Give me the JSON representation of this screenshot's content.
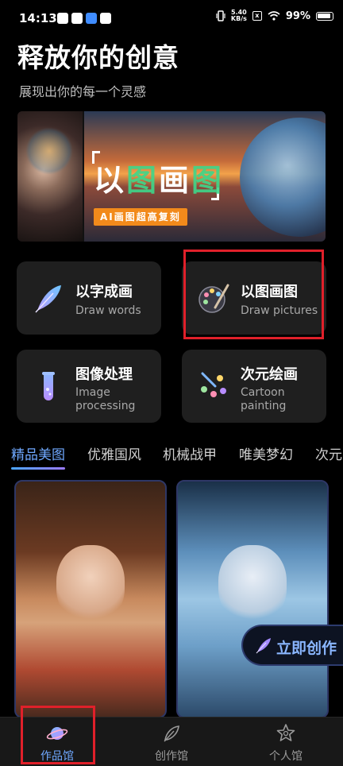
{
  "status_bar": {
    "time": "14:13",
    "net_speed_value": "5.40",
    "net_speed_unit": "KB/s",
    "battery": "99%",
    "sim_label": "x"
  },
  "header": {
    "title": "释放你的创意",
    "subtitle": "展现出你的每一个灵感"
  },
  "banner": {
    "title_part1": "以",
    "title_part2": "图",
    "title_part3": "画",
    "title_part4": "图",
    "tag": "AI画图超高复刻"
  },
  "features": [
    {
      "cn": "以字成画",
      "en": "Draw words",
      "icon": "feather-icon"
    },
    {
      "cn": "以图画图",
      "en": "Draw pictures",
      "icon": "palette-icon"
    },
    {
      "cn": "图像处理",
      "en": "Image processing",
      "icon": "test-tube-icon"
    },
    {
      "cn": "次元绘画",
      "en": "Cartoon painting",
      "icon": "paintbrush-icon"
    }
  ],
  "tabs": [
    "精品美图",
    "优雅国风",
    "机械战甲",
    "唯美梦幻",
    "次元"
  ],
  "cta": {
    "label": "立即创作"
  },
  "nav": [
    {
      "label": "作品馆",
      "icon": "planet-icon"
    },
    {
      "label": "创作馆",
      "icon": "leaf-icon"
    },
    {
      "label": "个人馆",
      "icon": "star-icon"
    }
  ],
  "colors": {
    "accent": "#6fa8ff",
    "highlight": "#e0202a",
    "tag_bg": "#f28a1b"
  }
}
